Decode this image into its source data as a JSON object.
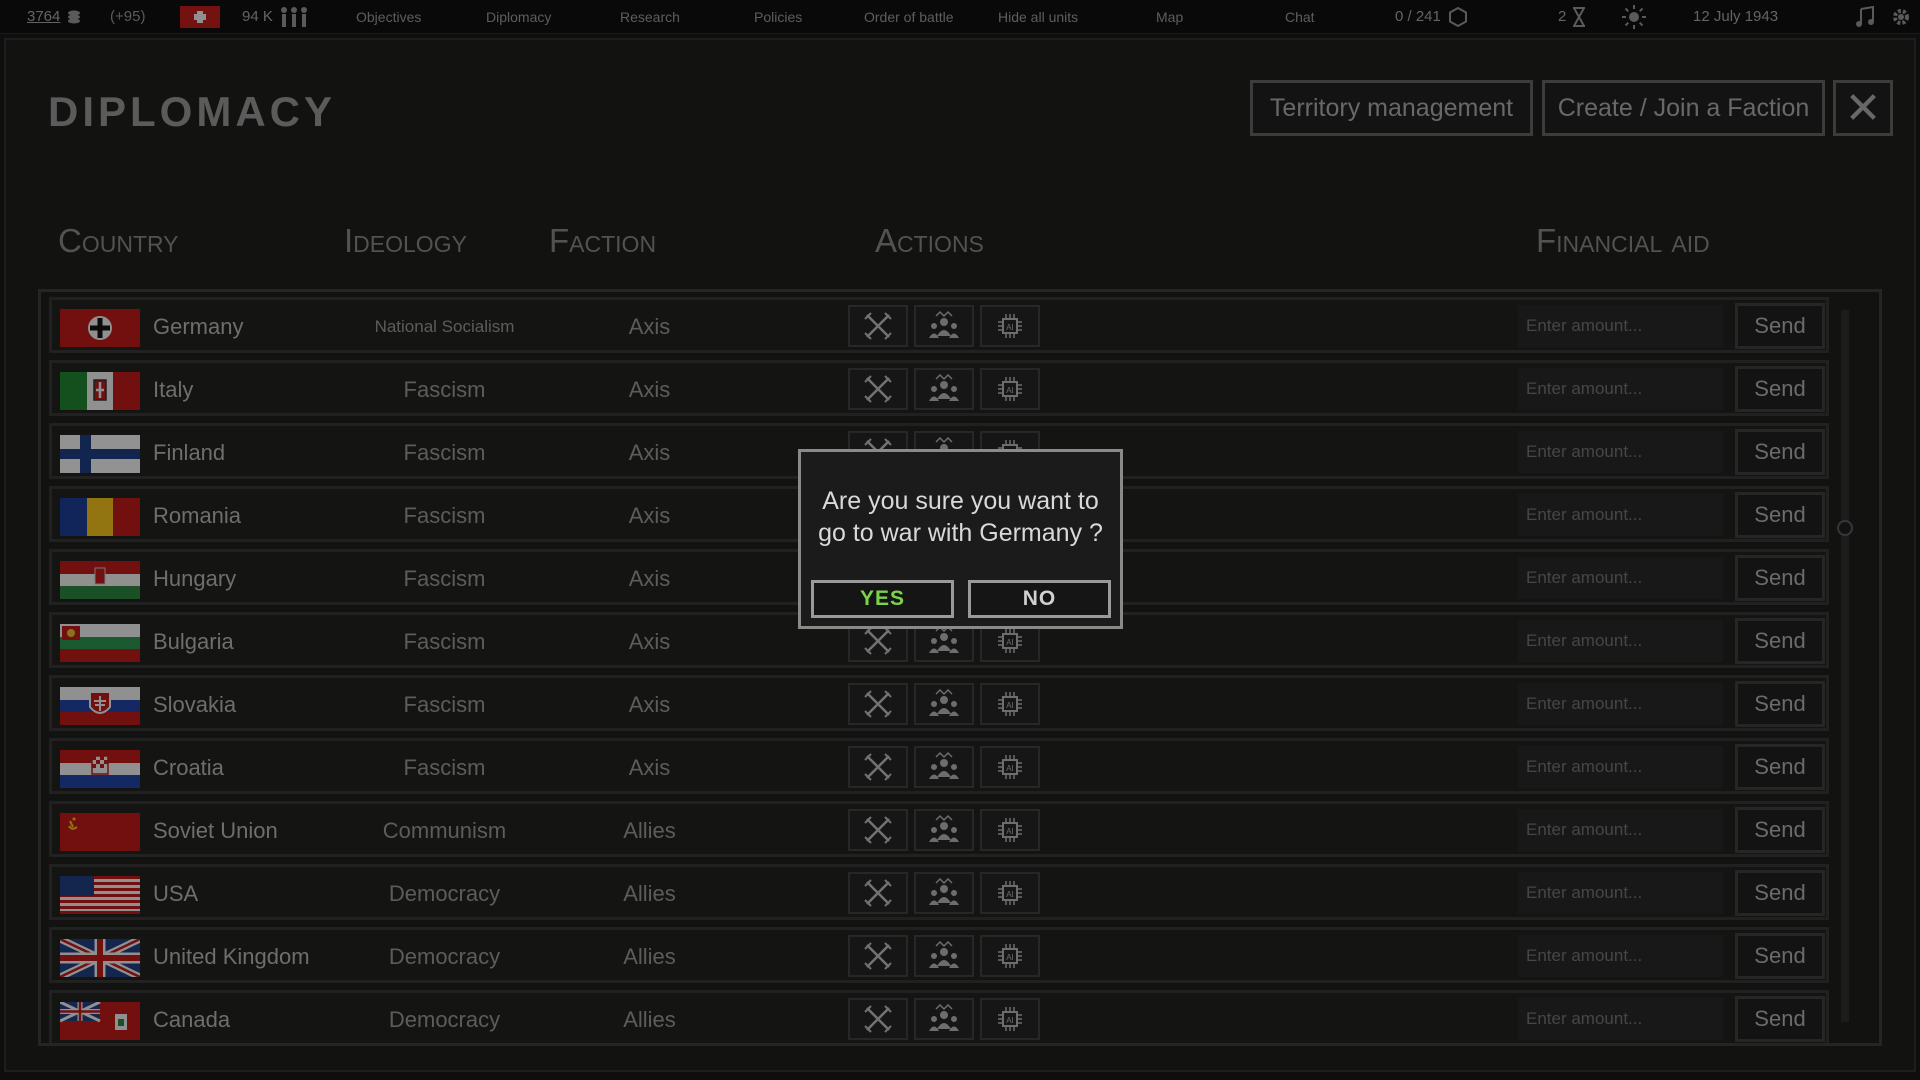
{
  "topbar": {
    "money": "3764",
    "money_delta": "(+95)",
    "manpower": "94 K",
    "links": [
      "Objectives",
      "Diplomacy",
      "Research",
      "Policies",
      "Order of battle",
      "Hide all units",
      "Map",
      "Chat"
    ],
    "players": "0 / 241",
    "hourglass_count": "2",
    "date": "12 July 1943"
  },
  "header": {
    "title": "DIPLOMACY",
    "territory_button": "Territory management",
    "faction_button": "Create / Join a Faction",
    "close_glyph": "✕"
  },
  "columns": {
    "country": "Country",
    "ideology": "Ideology",
    "faction": "Faction",
    "actions": "Actions",
    "financial_aid": "Financial aid"
  },
  "rows": [
    {
      "country": "Germany",
      "ideology": "National Socialism",
      "faction": "Axis",
      "flag": "germany"
    },
    {
      "country": "Italy",
      "ideology": "Fascism",
      "faction": "Axis",
      "flag": "italy"
    },
    {
      "country": "Finland",
      "ideology": "Fascism",
      "faction": "Axis",
      "flag": "finland"
    },
    {
      "country": "Romania",
      "ideology": "Fascism",
      "faction": "Axis",
      "flag": "romania"
    },
    {
      "country": "Hungary",
      "ideology": "Fascism",
      "faction": "Axis",
      "flag": "hungary"
    },
    {
      "country": "Bulgaria",
      "ideology": "Fascism",
      "faction": "Axis",
      "flag": "bulgaria"
    },
    {
      "country": "Slovakia",
      "ideology": "Fascism",
      "faction": "Axis",
      "flag": "slovakia"
    },
    {
      "country": "Croatia",
      "ideology": "Fascism",
      "faction": "Axis",
      "flag": "croatia"
    },
    {
      "country": "Soviet Union",
      "ideology": "Communism",
      "faction": "Allies",
      "flag": "ussr"
    },
    {
      "country": "USA",
      "ideology": "Democracy",
      "faction": "Allies",
      "flag": "usa"
    },
    {
      "country": "United Kingdom",
      "ideology": "Democracy",
      "faction": "Allies",
      "flag": "uk"
    },
    {
      "country": "Canada",
      "ideology": "Democracy",
      "faction": "Allies",
      "flag": "canada"
    }
  ],
  "amount_placeholder": "Enter amount...",
  "send_label": "Send",
  "modal": {
    "message": "Are you sure you want to go to war with Germany ?",
    "yes": "YES",
    "no": "NO"
  },
  "colors": {
    "yes_green": "#7bd24b",
    "panel_bg": "#1c1c1b",
    "topbar_bg": "#0f0f0f"
  }
}
